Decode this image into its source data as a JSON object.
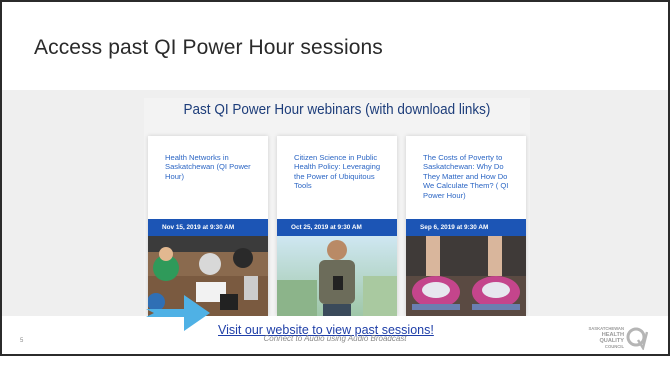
{
  "slide": {
    "title": "Access past QI Power Hour sessions",
    "number": "5",
    "footer": "Connect to Audio using Audio Broadcast"
  },
  "webinars": {
    "heading": "Past QI Power Hour webinars (with download links)",
    "cards": [
      {
        "title": "Health Networks in Saskatchewan (QI Power Hour)",
        "date": "Nov 15, 2019 at 9:30 AM"
      },
      {
        "title": "Citizen Science in Public Health Policy: Leveraging the Power of Ubiquitous Tools",
        "date": "Oct 25, 2019 at 9:30 AM"
      },
      {
        "title": "The Costs of Poverty to Saskatchewan: Why Do They Matter and How Do We Calculate Them? ( QI Power Hour)",
        "date": "Sep 6, 2019 at 9:30 AM"
      }
    ]
  },
  "cta": {
    "link_text": "Visit our website to view past sessions!"
  },
  "logo": {
    "line1": "SASKATCHEWAN",
    "line2": "HEALTH",
    "line3": "QUALITY",
    "line4": "COUNCIL"
  },
  "colors": {
    "date_bar": "#1c55b5",
    "card_title": "#2c66c4",
    "arrow": "#4fb1e5",
    "link": "#1f3fa8"
  }
}
